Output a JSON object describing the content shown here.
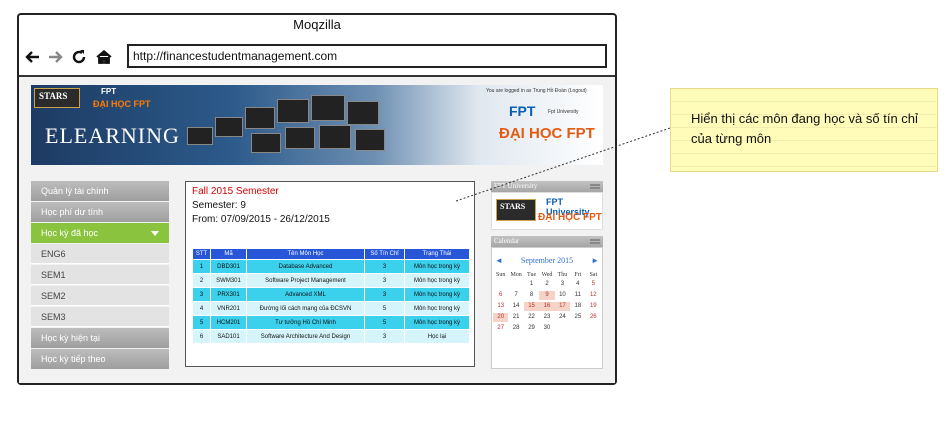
{
  "browser": {
    "title": "Moqzilla",
    "url": "http://financestudentmanagement.com",
    "icons": [
      "back-arrow-icon",
      "forward-arrow-icon",
      "reload-icon",
      "home-icon"
    ]
  },
  "banner": {
    "stars": "STARS",
    "fpt_small": "FPT",
    "daihoc_small": "ĐẠI HỌC FPT",
    "elearning": "ELEARNING",
    "logged": "You are logged in as Trung Hồ Đoàn (Logout)",
    "fpt_logo": "FPT",
    "fpt_university": "Fpt University",
    "daihoc_big": "ĐẠI HỌC FPT"
  },
  "menu": {
    "items": [
      {
        "label": "Quản lý tài chính"
      },
      {
        "label": "Học phí dư tính"
      },
      {
        "label": "Học kỳ đã học"
      },
      {
        "label": "ENG6"
      },
      {
        "label": "SEM1"
      },
      {
        "label": "SEM2"
      },
      {
        "label": "SEM3"
      },
      {
        "label": "Học kỳ hiện tại"
      },
      {
        "label": "Học kỳ tiếp theo"
      }
    ]
  },
  "semester": {
    "title": "Fall 2015 Semester",
    "semester_line": "Semester: 9",
    "from_line": "From: 07/09/2015 - 26/12/2015"
  },
  "table": {
    "headers": [
      "STT",
      "Mã",
      "Tên Môn Học",
      "Số Tín Chỉ",
      "Trạng Thái"
    ],
    "rows": [
      [
        "1",
        "DBD301",
        "Database Advanced",
        "3",
        "Môn học trong kỳ"
      ],
      [
        "2",
        "SWM301",
        "Software Project Management",
        "3",
        "Môn học trong kỳ"
      ],
      [
        "3",
        "PRX301",
        "Advanced XML",
        "3",
        "Môn học trong kỳ"
      ],
      [
        "4",
        "VNR201",
        "Đường lối cách mạng của ĐCSVN",
        "5",
        "Môn học trong kỳ"
      ],
      [
        "5",
        "HCM201",
        "Tư tưởng Hồ Chí Minh",
        "5",
        "Môn học trong kỳ"
      ],
      [
        "6",
        "SAD101",
        "Software Architecture And Design",
        "3",
        "Học lại"
      ]
    ]
  },
  "sidebar": {
    "fpt_box_title": "FPT University",
    "logo_stars": "STARS",
    "logo_fpt": "FPT University",
    "logo_daihoc": "ĐẠI HỌC FPT",
    "calendar_title": "Calendar",
    "prev": "◄",
    "next": "►",
    "month": "September 2015",
    "weekdays": [
      "Sun",
      "Mon",
      "Tue",
      "Wed",
      "Thu",
      "Fri",
      "Sat"
    ],
    "days": [
      [
        "",
        "",
        "1",
        "2",
        "3",
        "4",
        "5"
      ],
      [
        "6",
        "7",
        "8",
        "9",
        "10",
        "11",
        "12"
      ],
      [
        "13",
        "14",
        "15",
        "16",
        "17",
        "18",
        "19"
      ],
      [
        "20",
        "21",
        "22",
        "23",
        "24",
        "25",
        "26"
      ],
      [
        "27",
        "28",
        "29",
        "30",
        "",
        "",
        ""
      ]
    ]
  },
  "note": {
    "text": "Hiển thị các môn đang học và số tín chỉ của từng môn"
  }
}
